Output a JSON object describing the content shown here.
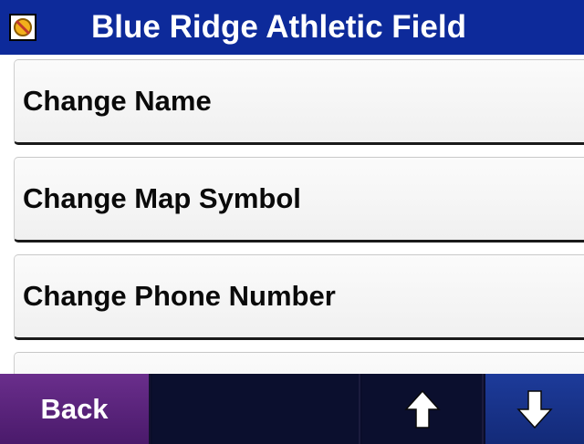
{
  "header": {
    "title": "Blue Ridge Athletic Field",
    "icon": "location-symbol-icon"
  },
  "menu": {
    "items": [
      {
        "label": "Change Name"
      },
      {
        "label": "Change Map Symbol"
      },
      {
        "label": "Change Phone Number"
      },
      {
        "label": ""
      }
    ]
  },
  "footer": {
    "back_label": "Back",
    "up_icon": "arrow-up-icon",
    "down_icon": "arrow-down-icon"
  },
  "colors": {
    "header_bg": "#0d2a9a",
    "back_button": "#5a2379",
    "footer_bg": "#0a0d2a",
    "down_button": "#1d3b9a"
  }
}
